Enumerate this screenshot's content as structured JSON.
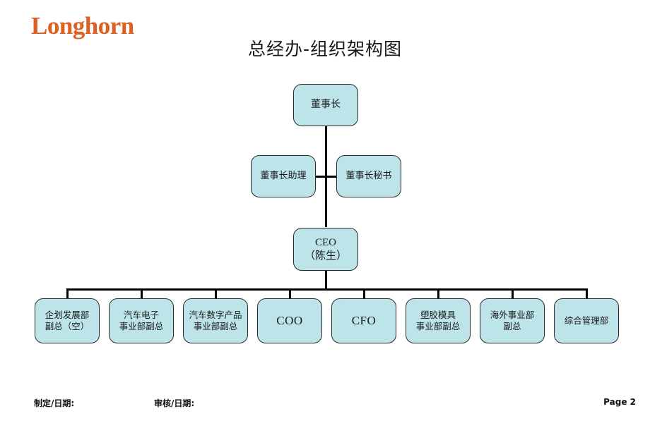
{
  "slide": {
    "logo": "Longhorn",
    "logo_color": "#DE5F20",
    "title": "总经办-组织架构图"
  },
  "footer": {
    "prepared": "制定/日期:",
    "reviewed": "审核/日期:",
    "page": "Page 2"
  },
  "chart_data": {
    "type": "diagram",
    "diagram_kind": "org-chart",
    "title": "总经办-组织架构图",
    "node_fill": "#BCE4E9",
    "node_border": "#2B2B2B",
    "connector_color": "#000000",
    "levels": [
      {
        "level": 1,
        "nodes": [
          {
            "id": "chairman",
            "label": "董事长"
          }
        ]
      },
      {
        "level": 2,
        "kind": "staff",
        "nodes": [
          {
            "id": "chairman_assistant",
            "label": "董事长助理"
          },
          {
            "id": "chairman_secretary",
            "label": "董事长秘书"
          }
        ]
      },
      {
        "level": 3,
        "nodes": [
          {
            "id": "ceo",
            "label": "CEO\n（陈生）"
          }
        ]
      },
      {
        "level": 4,
        "nodes": [
          {
            "id": "planning_dev",
            "label": "企划发展部\n副总（空）"
          },
          {
            "id": "auto_electronics",
            "label": "汽车电子\n事业部副总"
          },
          {
            "id": "auto_digital",
            "label": "汽车数字产品\n事业部副总"
          },
          {
            "id": "coo",
            "label": "COO"
          },
          {
            "id": "cfo",
            "label": "CFO"
          },
          {
            "id": "plastic_mold",
            "label": "塑胶模具\n事业部副总"
          },
          {
            "id": "overseas",
            "label": "海外事业部\n副总"
          },
          {
            "id": "general_mgmt",
            "label": "综合管理部"
          }
        ]
      }
    ],
    "edges": [
      {
        "from": "chairman",
        "to": "ceo"
      },
      {
        "from": "chairman_assistant",
        "to": "ceo",
        "style": "staff"
      },
      {
        "from": "chairman_secretary",
        "to": "ceo",
        "style": "staff"
      },
      {
        "from": "ceo",
        "to": "planning_dev"
      },
      {
        "from": "ceo",
        "to": "auto_electronics"
      },
      {
        "from": "ceo",
        "to": "auto_digital"
      },
      {
        "from": "ceo",
        "to": "coo"
      },
      {
        "from": "ceo",
        "to": "cfo"
      },
      {
        "from": "ceo",
        "to": "plastic_mold"
      },
      {
        "from": "ceo",
        "to": "overseas"
      },
      {
        "from": "ceo",
        "to": "general_mgmt"
      }
    ]
  }
}
